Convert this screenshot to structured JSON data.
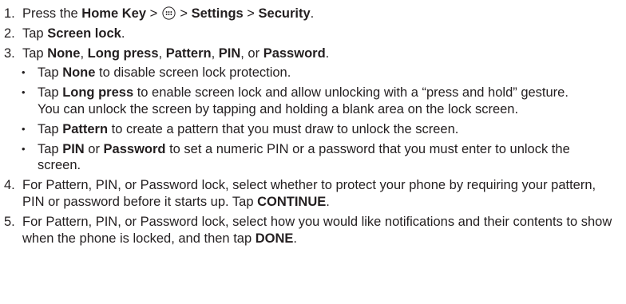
{
  "steps": [
    {
      "num": "1.",
      "parts": [
        {
          "t": "Press the "
        },
        {
          "t": "Home Key",
          "b": true
        },
        {
          "t": " > "
        },
        {
          "icon": "apps-icon"
        },
        {
          "t": " > "
        },
        {
          "t": "Settings",
          "b": true
        },
        {
          "t": " > "
        },
        {
          "t": "Security",
          "b": true
        },
        {
          "t": "."
        }
      ]
    },
    {
      "num": "2.",
      "parts": [
        {
          "t": "Tap "
        },
        {
          "t": "Screen lock",
          "b": true
        },
        {
          "t": "."
        }
      ]
    },
    {
      "num": "3.",
      "parts": [
        {
          "t": "Tap "
        },
        {
          "t": "None",
          "b": true
        },
        {
          "t": ", "
        },
        {
          "t": "Long press",
          "b": true
        },
        {
          "t": ", "
        },
        {
          "t": "Pattern",
          "b": true
        },
        {
          "t": ", "
        },
        {
          "t": "PIN",
          "b": true
        },
        {
          "t": ", or "
        },
        {
          "t": "Password",
          "b": true
        },
        {
          "t": "."
        }
      ],
      "bullets": [
        [
          {
            "t": "Tap "
          },
          {
            "t": "None",
            "b": true
          },
          {
            "t": " to disable screen lock protection."
          }
        ],
        [
          {
            "t": "Tap "
          },
          {
            "t": "Long press",
            "b": true
          },
          {
            "t": " to enable screen lock and allow unlocking with a “press and hold” gesture. You can unlock the screen by tapping and holding a blank area on the lock screen."
          }
        ],
        [
          {
            "t": "Tap "
          },
          {
            "t": "Pattern",
            "b": true
          },
          {
            "t": " to create a pattern that you must draw to unlock the screen."
          }
        ],
        [
          {
            "t": "Tap "
          },
          {
            "t": "PIN",
            "b": true
          },
          {
            "t": " or "
          },
          {
            "t": "Password",
            "b": true
          },
          {
            "t": " to set a numeric PIN or a password that you must enter to unlock the screen."
          }
        ]
      ]
    },
    {
      "num": "4.",
      "parts": [
        {
          "t": "For Pattern, PIN, or Password lock, select whether to protect your phone by requiring your pattern, PIN or password before it starts up. Tap "
        },
        {
          "t": "CONTINUE",
          "b": true
        },
        {
          "t": "."
        }
      ]
    },
    {
      "num": "5.",
      "parts": [
        {
          "t": "For Pattern, PIN, or Password lock, select how you would like notifications and their contents to show when the phone is locked, and then tap "
        },
        {
          "t": "DONE",
          "b": true
        },
        {
          "t": "."
        }
      ]
    }
  ],
  "bullet_glyph": "•"
}
